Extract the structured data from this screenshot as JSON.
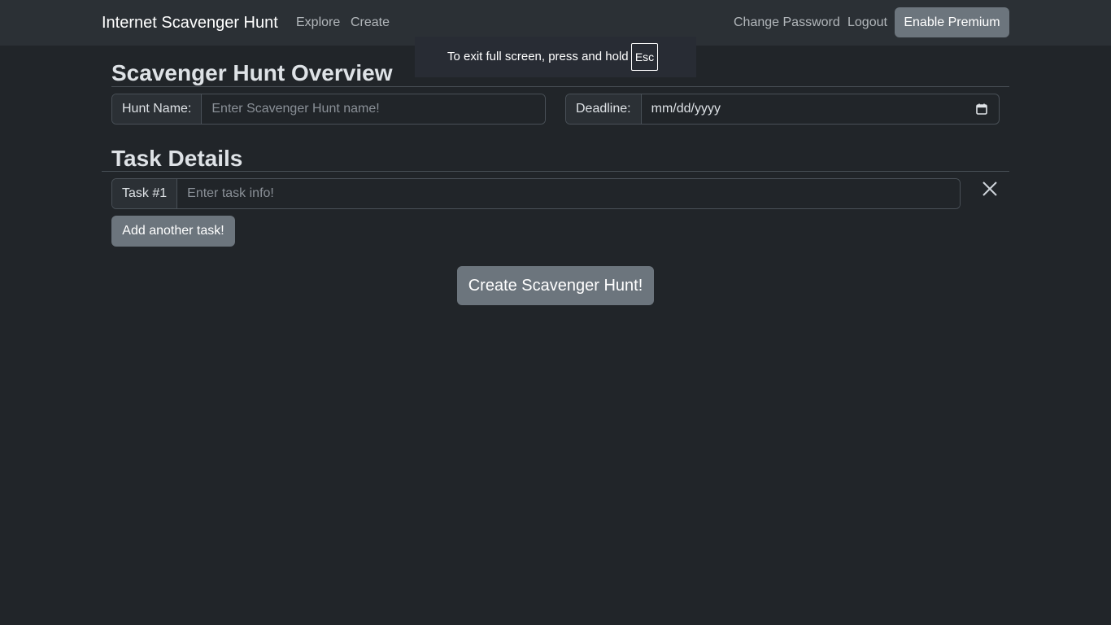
{
  "navbar": {
    "brand": "Internet Scavenger Hunt",
    "links": [
      "Explore",
      "Create"
    ],
    "right_links": [
      "Change Password",
      "Logout"
    ],
    "premium_button": "Enable Premium"
  },
  "fullscreen_notice": {
    "message": "To exit full screen, press and hold",
    "key": "Esc"
  },
  "overview": {
    "title": "Scavenger Hunt Overview",
    "hunt_name_label": "Hunt Name:",
    "hunt_name_placeholder": "Enter Scavenger Hunt name!",
    "deadline_label": "Deadline:",
    "deadline_value": "mm/dd/yyyy"
  },
  "tasks": {
    "title": "Task Details",
    "items": [
      {
        "label": "Task #1",
        "placeholder": "Enter task info!"
      }
    ],
    "add_button": "Add another task!"
  },
  "submit_button": "Create Scavenger Hunt!",
  "icons": {
    "remove_task": "close-icon",
    "deadline_picker": "calendar-icon"
  },
  "colors": {
    "background": "#212529",
    "navbar": "#2b3035",
    "button": "#6c757d"
  }
}
